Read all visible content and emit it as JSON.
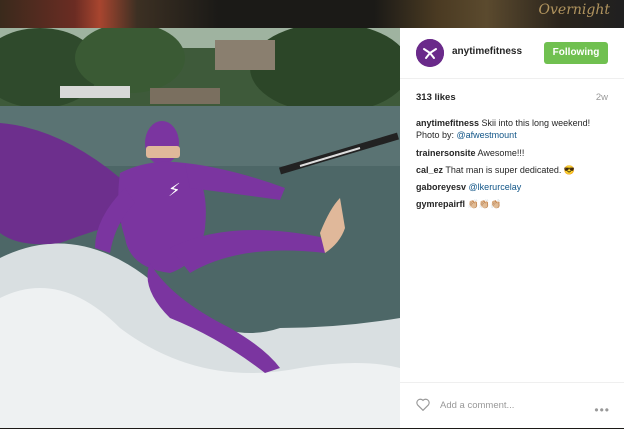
{
  "header": {
    "username": "anytimefitness",
    "follow_label": "Following"
  },
  "stats": {
    "likes": "313 likes",
    "time": "2w"
  },
  "comments": [
    {
      "user": "anytimefitness",
      "text": " Skii into this long weekend! Photo by: ",
      "mention": "@afwestmount"
    },
    {
      "user": "trainersonsite",
      "text": " Awesome!!!",
      "mention": ""
    },
    {
      "user": "cal_ez",
      "text": " That man is super dedicated. 😎",
      "mention": ""
    },
    {
      "user": "gaboreyesv",
      "text": " ",
      "mention": "@lkerurcelay"
    },
    {
      "user": "gymrepairfl",
      "text": " 👏🏼👏🏼👏🏼",
      "mention": ""
    }
  ],
  "footer": {
    "add_comment_placeholder": "Add a comment..."
  },
  "background": {
    "script_text": "Overnight"
  },
  "colors": {
    "follow_green": "#70c050",
    "brand_purple": "#6a2a8a",
    "mention_blue": "#125688"
  },
  "icons": [
    "heart-icon",
    "more-options-icon",
    "anytime-fitness-logo"
  ]
}
